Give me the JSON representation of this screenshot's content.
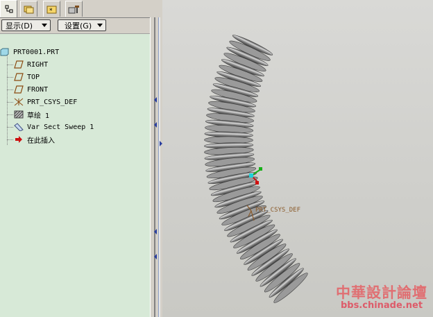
{
  "tabs": [
    {
      "icon": "model-tree-icon"
    },
    {
      "icon": "folder-browser-icon"
    },
    {
      "icon": "favorites-icon"
    },
    {
      "icon": "tools-icon"
    }
  ],
  "toolbar": {
    "show_label": "显示(D)",
    "settings_label": "设置(G)"
  },
  "tree": {
    "root": "PRT0001.PRT",
    "items": [
      {
        "label": "RIGHT",
        "icon": "datum-plane-icon"
      },
      {
        "label": "TOP",
        "icon": "datum-plane-icon"
      },
      {
        "label": "FRONT",
        "icon": "datum-plane-icon"
      },
      {
        "label": "PRT_CSYS_DEF",
        "icon": "csys-icon"
      },
      {
        "label": "草绘 1",
        "icon": "sketch-icon"
      },
      {
        "label": "Var Sect Sweep 1",
        "icon": "sweep-icon"
      },
      {
        "label": "在此插入",
        "icon": "insert-here-icon"
      }
    ]
  },
  "viewport": {
    "csys_label": "PRT_CSYS_DEF"
  },
  "watermark": {
    "title": "中華設計論壇",
    "url": "bbs.chinade.net"
  }
}
